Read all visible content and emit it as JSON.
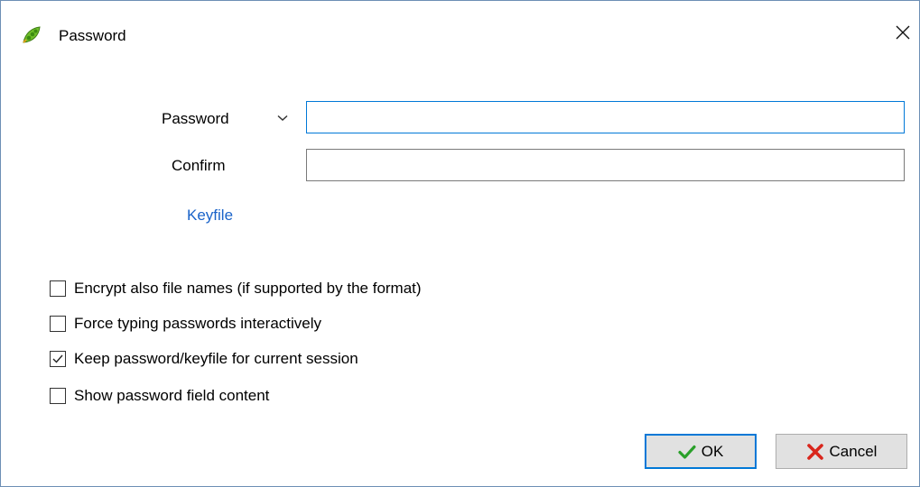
{
  "window": {
    "title": "Password",
    "app_icon": "peazip-icon",
    "close_icon": "close-icon"
  },
  "form": {
    "password_label": "Password",
    "password_value": "",
    "password_history_icon": "chevron-down-icon",
    "confirm_label": "Confirm",
    "confirm_value": "",
    "keyfile_link": "Keyfile"
  },
  "options": [
    {
      "label": "Encrypt also file names (if supported by the format)",
      "checked": false
    },
    {
      "label": "Force typing passwords interactively",
      "checked": false
    },
    {
      "label": "Keep password/keyfile for current session",
      "checked": true
    },
    {
      "label": "Show password field content",
      "checked": false
    }
  ],
  "buttons": {
    "ok_label": "OK",
    "ok_icon": "checkmark-icon",
    "cancel_label": "Cancel",
    "cancel_icon": "x-icon"
  },
  "colors": {
    "focus_accent": "#0078d7",
    "link": "#1a63c9",
    "ok_check": "#2aa02a",
    "cancel_x": "#d9261c"
  }
}
